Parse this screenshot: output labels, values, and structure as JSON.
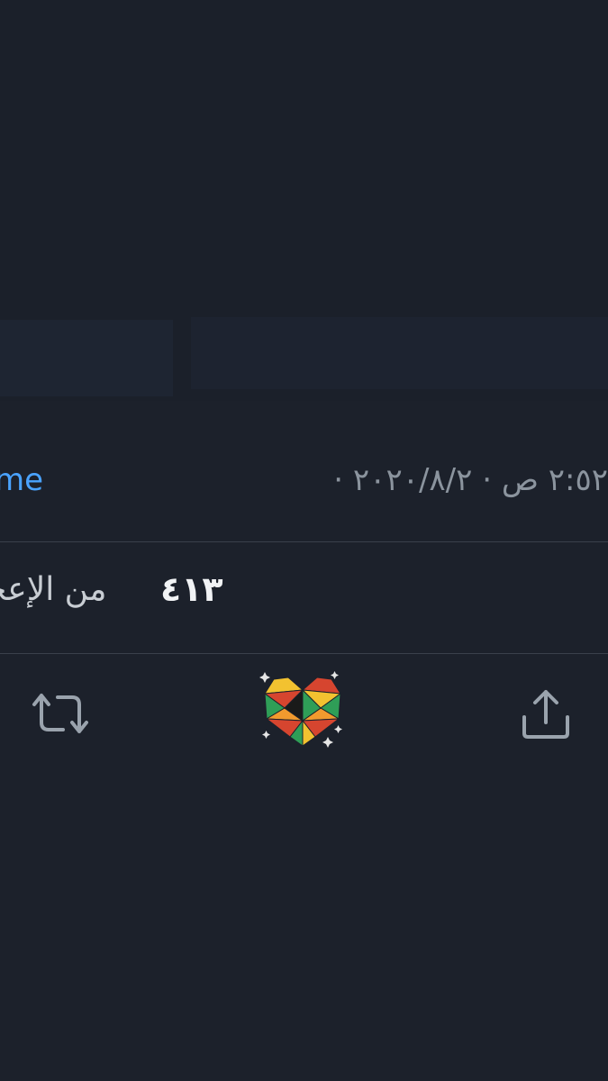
{
  "tweet": {
    "timestamp": "٢:٥٢ ص · ٢٠٢٠/٨/٢ · ",
    "source": "me",
    "likes_count": "٤١٣",
    "likes_label": "من الإعجا"
  },
  "actions": {
    "icons": [
      "retweet-icon",
      "heart-mosaic-icon",
      "share-icon"
    ]
  },
  "colors": {
    "background": "#1c212b",
    "link": "#4aa3ff",
    "muted_text": "#8b949e",
    "divider": "#3a404b"
  }
}
